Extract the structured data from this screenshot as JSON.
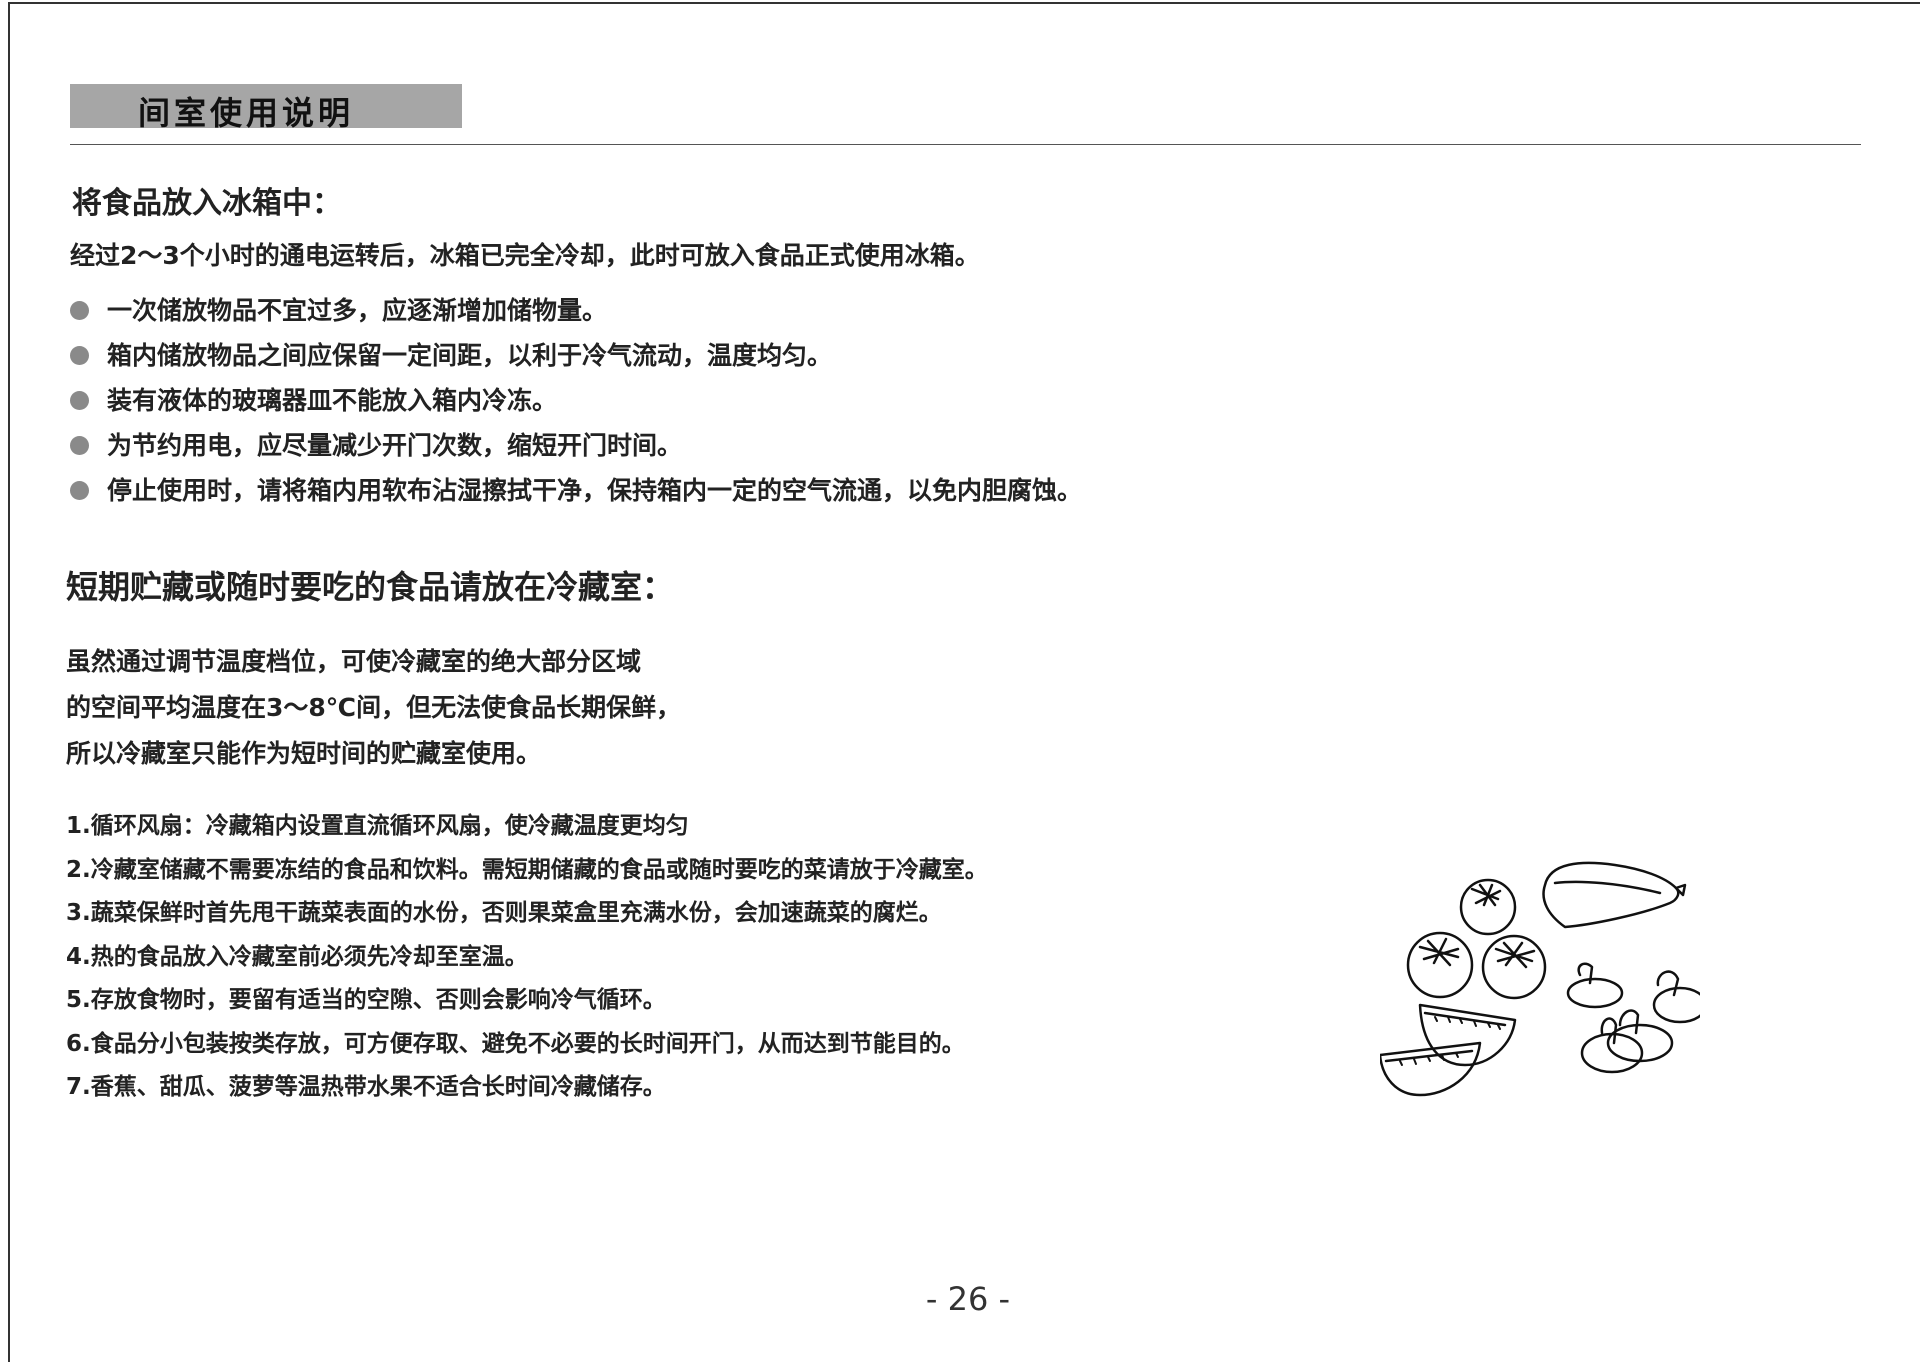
{
  "header": {
    "banner_title": "间室使用说明"
  },
  "section1": {
    "title": "将食品放入冰箱中：",
    "intro": "经过2～3个小时的通电运转后，冰箱已完全冷却，此时可放入食品正式使用冰箱。",
    "bullets": [
      "一次储放物品不宜过多，应逐渐增加储物量。",
      "箱内储放物品之间应保留一定间距，以利于冷气流动，温度均匀。",
      "装有液体的玻璃器皿不能放入箱内冷冻。",
      "为节约用电，应尽量减少开门次数，缩短开门时间。",
      "停止使用时，请将箱内用软布沾湿擦拭干净，保持箱内一定的空气流通，以免内胆腐蚀。"
    ]
  },
  "section2": {
    "title": "短期贮藏或随时要吃的食品请放在冷藏室：",
    "paragraph_lines": [
      "虽然通过调节温度档位，可使冷藏室的绝大部分区域",
      "的空间平均温度在3～8℃间，但无法使食品长期保鲜，",
      "所以冷藏室只能作为短时间的贮藏室使用。"
    ],
    "items": [
      "1.循环风扇：冷藏箱内设置直流循环风扇，使冷藏温度更均匀",
      "2.冷藏室储藏不需要冻结的食品和饮料。需短期储藏的食品或随时要吃的菜请放于冷藏室。",
      "3.蔬菜保鲜时首先甩干蔬菜表面的水份，否则果菜盒里充满水份，会加速蔬菜的腐烂。",
      "4.热的食品放入冷藏室前必须先冷却至室温。",
      "5.存放食物时，要留有适当的空隙、否则会影响冷气循环。",
      "6.食品分小包装按类存放，可方便存取、避免不必要的长时间开门，从而达到节能目的。",
      "7.香蕉、甜瓜、菠萝等温热带水果不适合长时间冷藏储存。"
    ]
  },
  "illustration": {
    "icon": "food-sketch-icon"
  },
  "footer": {
    "page_number": "- 26 -"
  },
  "colors": {
    "banner": "#a6a6a6",
    "bullet": "#8a8a8a",
    "text": "#222222"
  }
}
